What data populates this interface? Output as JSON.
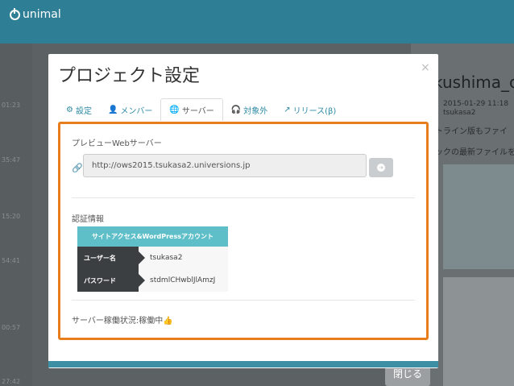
{
  "app": {
    "logo_text": "unimal"
  },
  "background": {
    "left_times": [
      "01:23",
      "35:47",
      "15:20",
      "54:41",
      "00:57",
      "27:42"
    ],
    "right": {
      "title": "kushima_c",
      "date": "2015-01-29 11:18",
      "user": "tsukasa2",
      "line1": "トライン版もファイ",
      "line2": "ックの最新ファイルを"
    },
    "close_label": "閉じる"
  },
  "modal": {
    "title": "プロジェクト設定",
    "close_symbol": "×",
    "tabs": [
      {
        "label": "設定",
        "icon": "gear-icon"
      },
      {
        "label": "メンバー",
        "icon": "user-icon"
      },
      {
        "label": "サーバー",
        "icon": "globe-icon",
        "active": true
      },
      {
        "label": "対象外",
        "icon": "headphones-icon"
      },
      {
        "label": "リリース(β)",
        "icon": "external-link-icon"
      }
    ],
    "preview": {
      "title": "プレビューWebサーバー",
      "url": "http://ows2015.tsukasa2.universions.jp"
    },
    "auth": {
      "title": "認証情報",
      "header": "サイトアクセス&WordPressアカウント",
      "rows": [
        {
          "key": "ユーザー名",
          "value": "tsukasa2"
        },
        {
          "key": "パスワード",
          "value": "stdmlCHwblJlAmzJ"
        }
      ]
    },
    "status": "サーバー稼働状況:稼働中"
  },
  "colors": {
    "accent": "#2e7f96",
    "highlight": "#e87d1e",
    "tab_link": "#2d8aa4"
  }
}
